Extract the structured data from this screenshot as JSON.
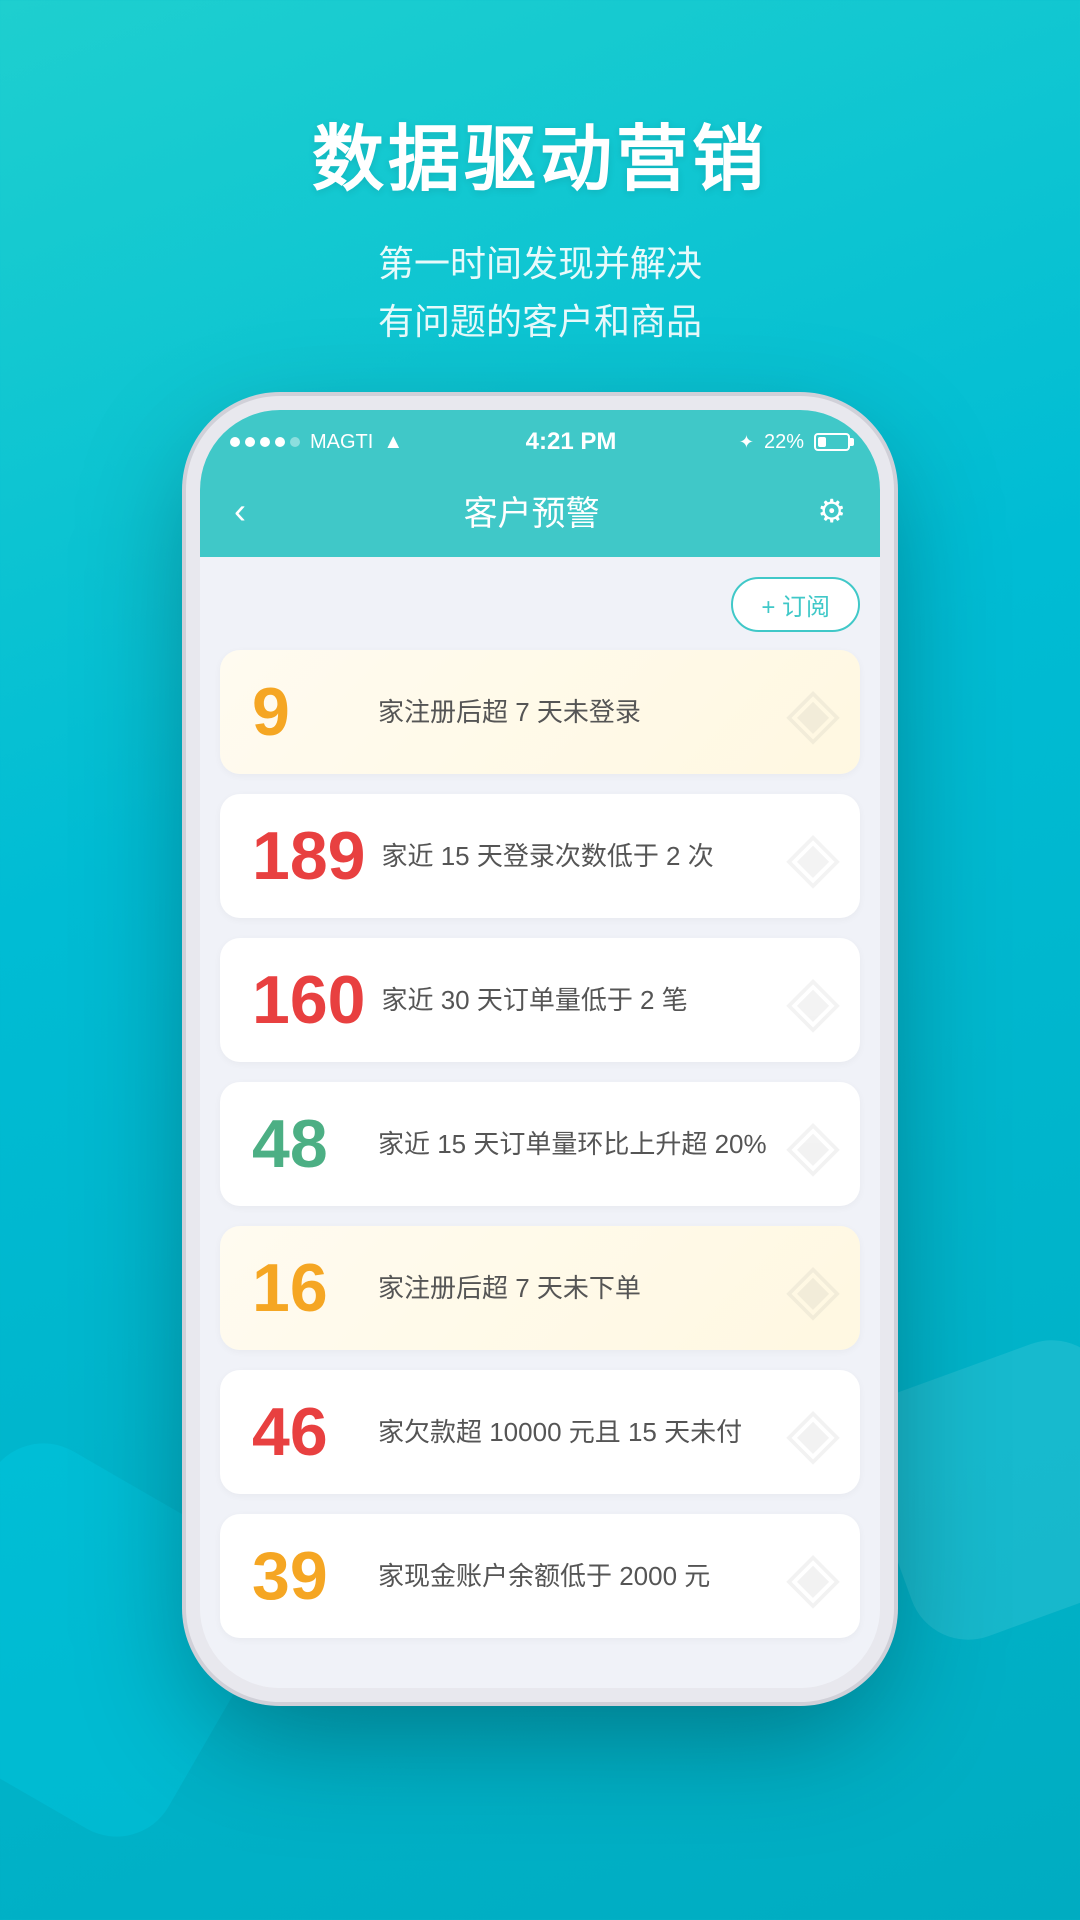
{
  "page": {
    "background_color": "#1ecfcf",
    "header": {
      "title": "数据驱动营销",
      "subtitle_line1": "第一时间发现并解决",
      "subtitle_line2": "有问题的客户和商品"
    },
    "status_bar": {
      "carrier": "MAGTI",
      "time": "4:21 PM",
      "battery_pct": "22%",
      "bluetooth": "B"
    },
    "nav": {
      "title": "客户预警",
      "back_icon": "‹",
      "settings_icon": "⚙"
    },
    "subscribe_button": "+ 订阅",
    "alerts": [
      {
        "number": "9",
        "number_color": "orange",
        "text": "家注册后超 7 天未登录",
        "card_style": "yellow"
      },
      {
        "number": "189",
        "number_color": "red",
        "text": "家近 15 天登录次数低于 2 次",
        "card_style": "white"
      },
      {
        "number": "160",
        "number_color": "red",
        "text": "家近 30 天订单量低于 2 笔",
        "card_style": "white"
      },
      {
        "number": "48",
        "number_color": "green",
        "text": "家近 15 天订单量环比上升超 20%",
        "card_style": "white"
      },
      {
        "number": "16",
        "number_color": "orange",
        "text": "家注册后超 7 天未下单",
        "card_style": "yellow"
      },
      {
        "number": "46",
        "number_color": "red",
        "text": "家欠款超 10000 元且 15 天未付",
        "card_style": "white"
      },
      {
        "number": "39",
        "number_color": "orange",
        "text": "家现金账户余额低于 2000 元",
        "card_style": "white"
      }
    ]
  }
}
